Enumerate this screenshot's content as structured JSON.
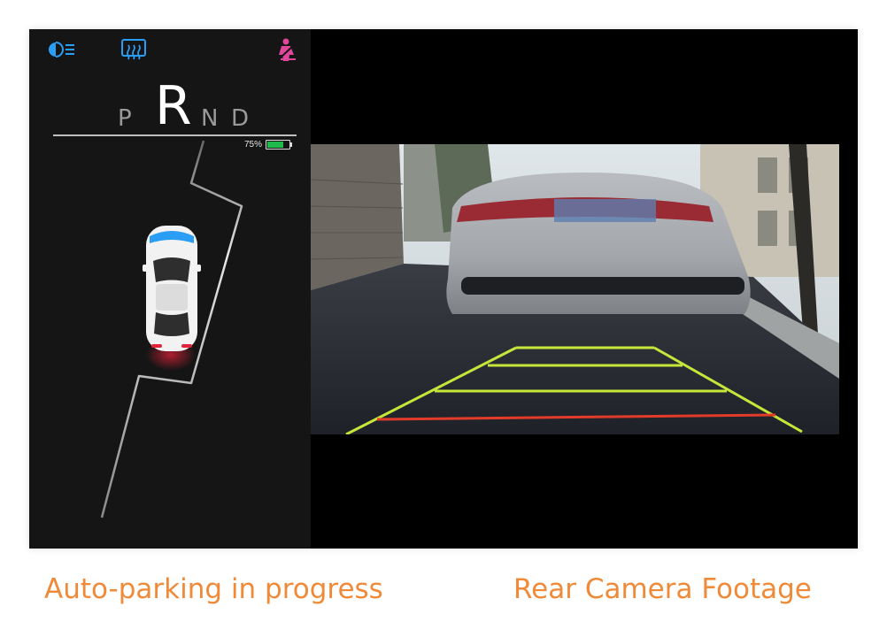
{
  "status_icons": [
    "headlight-icon",
    "rear-defrost-icon",
    "seatbelt-warning-icon"
  ],
  "gear_selector": {
    "gears": [
      "P",
      "R",
      "N",
      "D"
    ],
    "active": "R"
  },
  "battery": {
    "percent_label": "75%",
    "level": 0.75,
    "color": "#1fb84a"
  },
  "captions": {
    "left": "Auto-parking in progress",
    "right": "Rear Camera Footage"
  },
  "colors": {
    "accent_blue": "#2a9df4",
    "seatbelt_pink": "#e0479a",
    "caption_orange": "#ef8a39",
    "guide_near": "#e23b2a",
    "guide_far": "#c8e63a"
  }
}
